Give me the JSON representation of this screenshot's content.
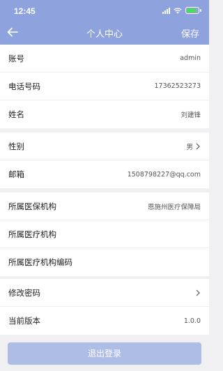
{
  "status": {
    "time": "12:45"
  },
  "nav": {
    "title": "个人中心",
    "save_label": "保存"
  },
  "group1": [
    {
      "label": "账号",
      "value": "admin"
    },
    {
      "label": "电话号码",
      "value": "17362523273"
    },
    {
      "label": "姓名",
      "value": "刘建锋"
    }
  ],
  "group2": [
    {
      "label": "性别",
      "value": "男"
    },
    {
      "label": "邮箱",
      "value": "1508798227@qq.com"
    }
  ],
  "group3": [
    {
      "label": "所属医保机构",
      "value": "恩施州医疗保障局"
    },
    {
      "label": "所属医疗机构",
      "value": ""
    },
    {
      "label": "所属医疗机构编码",
      "value": ""
    }
  ],
  "group4": [
    {
      "label": "修改密码",
      "value": ""
    },
    {
      "label": "当前版本",
      "value": "1.0.0"
    }
  ],
  "logout_label": "退出登录",
  "colors": {
    "header": "#8ea2dd",
    "logout_button": "#aebde6",
    "background": "#f0f0f3"
  }
}
